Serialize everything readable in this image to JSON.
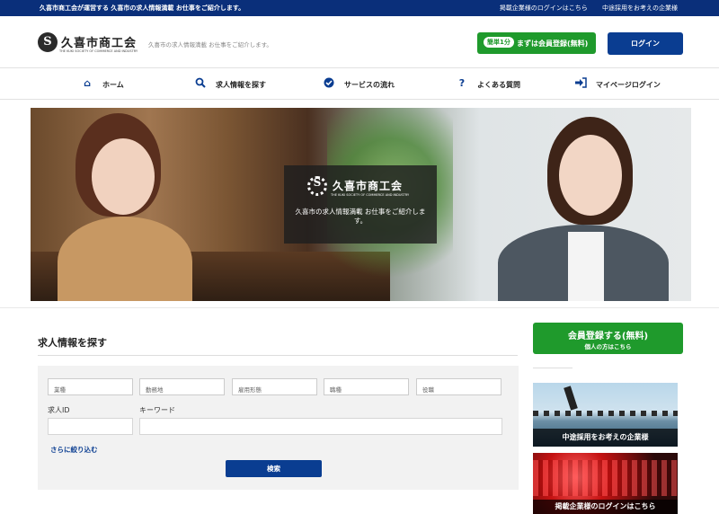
{
  "topbar": {
    "message": "久喜市商工会が運営する 久喜市の求人情報満載 お仕事をご紹介します。",
    "link_employer_login": "掲載企業様のログインはこちら",
    "link_midcareer": "中途採用をお考えの企業様"
  },
  "header": {
    "logo_letter": "S",
    "logo_name": "久喜市商工会",
    "logo_en": "THE KUKI SOCIETY OF COMMERCE AND INDUSTRY",
    "tagline": "久喜市の求人情報満載 お仕事をご紹介します。",
    "register_pill": "簡単1分",
    "register_label": "まずは会員登録(無料)",
    "login_label": "ログイン"
  },
  "nav": {
    "items": [
      {
        "label": "ホーム",
        "icon": "home-icon"
      },
      {
        "label": "求人情報を探す",
        "icon": "search-icon"
      },
      {
        "label": "サービスの流れ",
        "icon": "check-circle-icon"
      },
      {
        "label": "よくある質問",
        "icon": "question-icon"
      },
      {
        "label": "マイページログイン",
        "icon": "sign-in-icon"
      }
    ]
  },
  "hero": {
    "logo_letter": "S",
    "logo_name": "久喜市商工会",
    "logo_en": "THE KUKI SOCIETY OF COMMERCE AND INDUSTRY",
    "caption": "久喜市の求人情報満載 お仕事をご紹介します。"
  },
  "search": {
    "title": "求人情報を探す",
    "selects": [
      "業種",
      "勤務地",
      "雇用形態",
      "職種",
      "役職"
    ],
    "job_id_label": "求人ID",
    "job_id_value": "",
    "keyword_label": "キーワード",
    "keyword_value": "",
    "refine_label": "さらに絞り込む",
    "submit_label": "検索"
  },
  "sidebar": {
    "register_icon": "",
    "register_title": "会員登録する(無料)",
    "register_sub": "個人の方はこちら",
    "banner1_caption": "中途採用をお考えの企業様",
    "banner2_caption": "掲載企業様のログインはこちら"
  },
  "colors": {
    "navy": "#0a2f7a",
    "primary_blue": "#0a3d91",
    "green": "#1f9a2c"
  }
}
